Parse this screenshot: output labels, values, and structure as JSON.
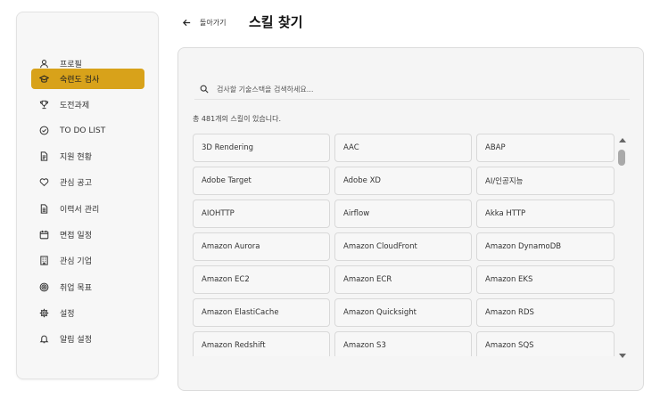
{
  "sidebar": {
    "items": [
      {
        "label": "프로필",
        "icon": "user-icon",
        "active": false
      },
      {
        "label": "숙련도 검사",
        "icon": "graduation-cap-icon",
        "active": true
      },
      {
        "label": "도전과제",
        "icon": "trophy-icon",
        "active": false
      },
      {
        "label": "TO DO LIST",
        "icon": "check-circle-icon",
        "active": false
      },
      {
        "label": "지원 현황",
        "icon": "document-icon",
        "active": false
      },
      {
        "label": "관심 공고",
        "icon": "heart-icon",
        "active": false
      },
      {
        "label": "이력서 관리",
        "icon": "file-text-icon",
        "active": false
      },
      {
        "label": "면접 일정",
        "icon": "calendar-icon",
        "active": false
      },
      {
        "label": "관심 기업",
        "icon": "building-icon",
        "active": false
      },
      {
        "label": "취업 목표",
        "icon": "target-icon",
        "active": false
      },
      {
        "label": "설정",
        "icon": "gear-icon",
        "active": false
      },
      {
        "label": "알림 설정",
        "icon": "bell-icon",
        "active": false
      }
    ],
    "accent_color": "#d8a21a"
  },
  "header": {
    "back_label": "돌아가기",
    "title": "스킬 찾기"
  },
  "search": {
    "placeholder": "검사할 기술스택을 검색하세요..."
  },
  "results": {
    "count_text": "총 481개의 스킬이 있습니다.",
    "skills": [
      "3D Rendering",
      "AAC",
      "ABAP",
      "Adobe Target",
      "Adobe XD",
      "AI/인공지능",
      "AIOHTTP",
      "Airflow",
      "Akka HTTP",
      "Amazon Aurora",
      "Amazon CloudFront",
      "Amazon DynamoDB",
      "Amazon EC2",
      "Amazon ECR",
      "Amazon EKS",
      "Amazon ElastiCache",
      "Amazon Quicksight",
      "Amazon RDS",
      "Amazon Redshift",
      "Amazon S3",
      "Amazon SQS"
    ]
  }
}
